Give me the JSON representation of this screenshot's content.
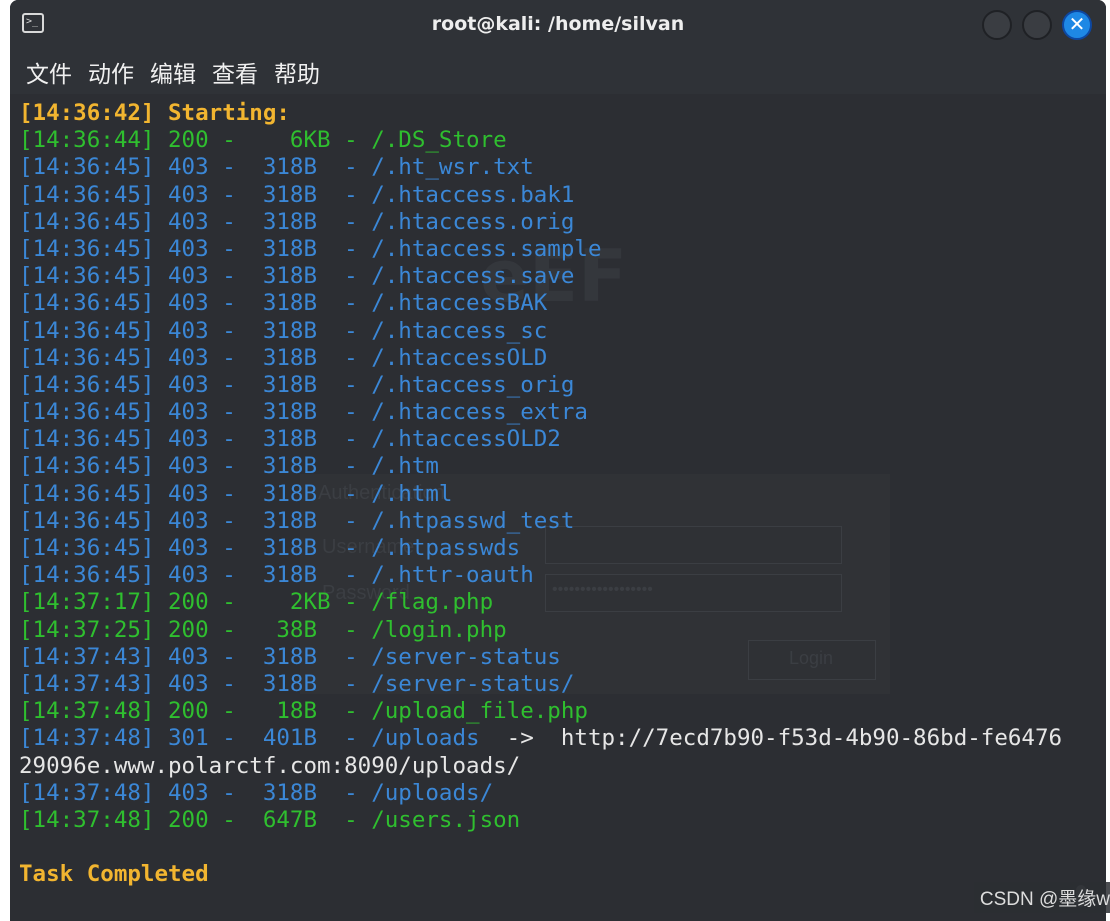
{
  "window": {
    "title": "root@kali: /home/silvan",
    "close_glyph": "✕"
  },
  "menu": [
    "文件",
    "动作",
    "编辑",
    "查看",
    "帮助"
  ],
  "watermark": {
    "logo": "eEF",
    "form_title": "Authentication",
    "username_label": "Username",
    "password_label": "Password",
    "password_dots": "••••••••••••••••••",
    "login_label": "Login"
  },
  "terminal": {
    "lines": [
      {
        "text": "[14:36:42] Starting:",
        "style": "yellow"
      },
      {
        "text": "[14:36:44] 200 -    6KB - /.DS_Store",
        "style": "green"
      },
      {
        "text": "[14:36:45] 403 -  318B  - /.ht_wsr.txt",
        "style": "blue"
      },
      {
        "text": "[14:36:45] 403 -  318B  - /.htaccess.bak1",
        "style": "blue"
      },
      {
        "text": "[14:36:45] 403 -  318B  - /.htaccess.orig",
        "style": "blue"
      },
      {
        "text": "[14:36:45] 403 -  318B  - /.htaccess.sample",
        "style": "blue"
      },
      {
        "text": "[14:36:45] 403 -  318B  - /.htaccess.save",
        "style": "blue"
      },
      {
        "text": "[14:36:45] 403 -  318B  - /.htaccessBAK",
        "style": "blue"
      },
      {
        "text": "[14:36:45] 403 -  318B  - /.htaccess_sc",
        "style": "blue"
      },
      {
        "text": "[14:36:45] 403 -  318B  - /.htaccessOLD",
        "style": "blue"
      },
      {
        "text": "[14:36:45] 403 -  318B  - /.htaccess_orig",
        "style": "blue"
      },
      {
        "text": "[14:36:45] 403 -  318B  - /.htaccess_extra",
        "style": "blue"
      },
      {
        "text": "[14:36:45] 403 -  318B  - /.htaccessOLD2",
        "style": "blue"
      },
      {
        "text": "[14:36:45] 403 -  318B  - /.htm",
        "style": "blue"
      },
      {
        "text": "[14:36:45] 403 -  318B  - /.html",
        "style": "blue"
      },
      {
        "text": "[14:36:45] 403 -  318B  - /.htpasswd_test",
        "style": "blue"
      },
      {
        "text": "[14:36:45] 403 -  318B  - /.htpasswds",
        "style": "blue"
      },
      {
        "text": "[14:36:45] 403 -  318B  - /.httr-oauth",
        "style": "blue"
      },
      {
        "text": "[14:37:17] 200 -    2KB - /flag.php",
        "style": "green"
      },
      {
        "text": "[14:37:25] 200 -   38B  - /login.php",
        "style": "green"
      },
      {
        "text": "[14:37:43] 403 -  318B  - /server-status",
        "style": "blue"
      },
      {
        "text": "[14:37:43] 403 -  318B  - /server-status/",
        "style": "blue"
      },
      {
        "text": "[14:37:48] 200 -   18B  - /upload_file.php",
        "style": "green"
      },
      {
        "text": "[14:37:48] 301 -  401B  - /uploads  ",
        "style": "blue",
        "suffix": "->  http://7ecd7b90-f53d-4b90-86bd-fe6476"
      },
      {
        "text": "29096e.www.polarctf.com:8090/uploads/",
        "style": "white"
      },
      {
        "text": "[14:37:48] 403 -  318B  - /uploads/",
        "style": "blue"
      },
      {
        "text": "[14:37:48] 200 -  647B  - /users.json",
        "style": "green"
      },
      {
        "text": "",
        "style": "white"
      },
      {
        "text": "Task Completed",
        "style": "yellow"
      }
    ]
  },
  "footer": {
    "brand": "CSDN @墨缘w"
  }
}
